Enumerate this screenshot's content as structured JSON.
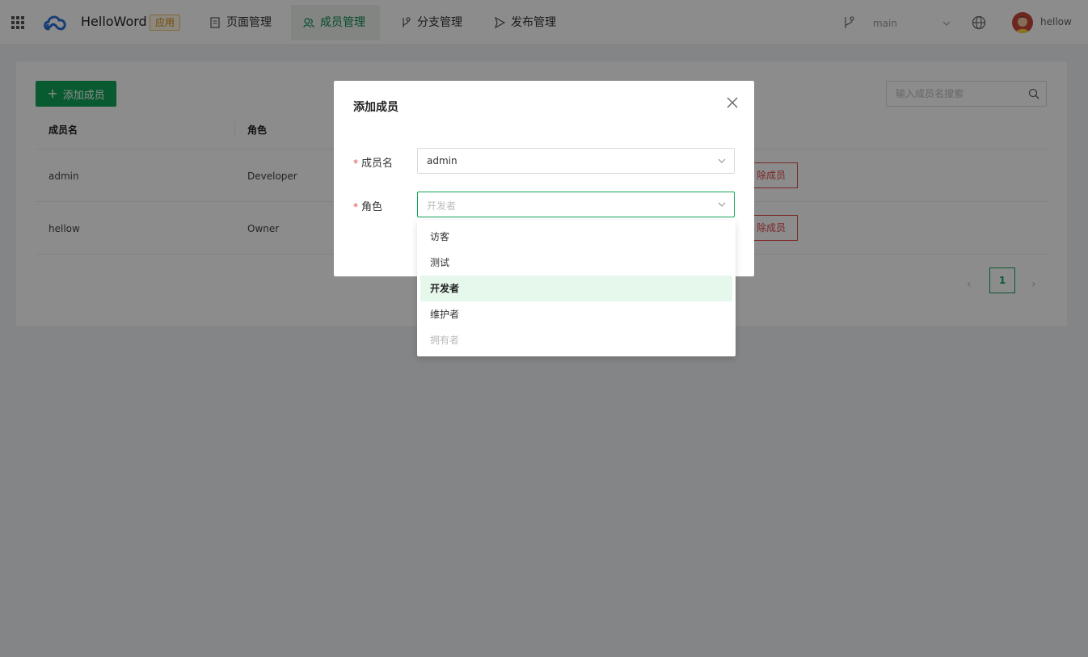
{
  "topnav": {
    "app_name": "HelloWord",
    "app_badge": "应用",
    "tabs": [
      {
        "label": "页面管理"
      },
      {
        "label": "成员管理"
      },
      {
        "label": "分支管理"
      },
      {
        "label": "发布管理"
      }
    ],
    "active_tab": "成员管理",
    "branch": "main",
    "username": "hellow"
  },
  "members_page": {
    "add_button_label": "添加成员",
    "search_placeholder": "输入成员名搜索",
    "columns": [
      "成员名",
      "角色"
    ],
    "rows": [
      {
        "name": "admin",
        "role": "Developer",
        "action": "除成员"
      },
      {
        "name": "hellow",
        "role": "Owner",
        "action": "除成员"
      }
    ],
    "pagination": {
      "current": "1",
      "prev": "‹",
      "next": "›"
    }
  },
  "modal": {
    "title": "添加成员",
    "fields": [
      {
        "label": "成员名",
        "required_mark": "*",
        "value": "admin"
      },
      {
        "label": "角色",
        "required_mark": "*",
        "placeholder": "开发者"
      }
    ]
  },
  "role_dropdown": {
    "options": [
      {
        "label": "访客",
        "state": "normal"
      },
      {
        "label": "测试",
        "state": "normal"
      },
      {
        "label": "开发者",
        "state": "selected"
      },
      {
        "label": "维护者",
        "state": "normal"
      },
      {
        "label": "拥有者",
        "state": "disabled"
      }
    ]
  },
  "colors": {
    "accent": "#11a558",
    "danger": "#e04848",
    "badge": "#d48806"
  }
}
